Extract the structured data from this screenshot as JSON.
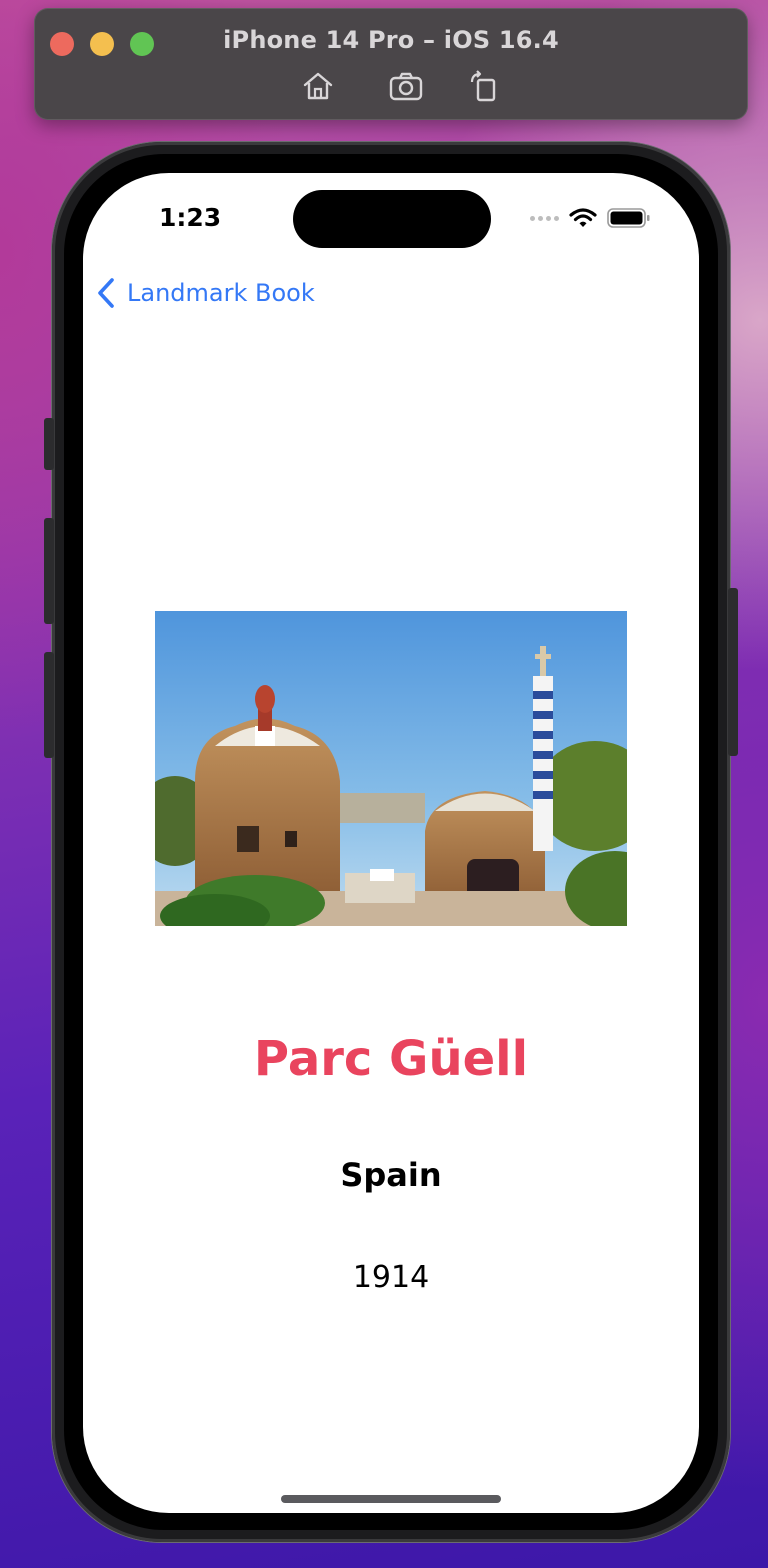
{
  "simulator": {
    "title": "iPhone 14 Pro – iOS 16.4",
    "tools": [
      "home-icon",
      "screenshot-icon",
      "rotate-icon"
    ]
  },
  "status_bar": {
    "time": "1:23",
    "icons": [
      "cellular-dots-icon",
      "wifi-icon",
      "battery-icon"
    ]
  },
  "nav": {
    "back_label": "Landmark Book"
  },
  "landmark": {
    "image": "Parc Güell photo",
    "name": "Parc Güell",
    "country": "Spain",
    "year": "1914",
    "name_color": "#e9445e"
  },
  "colors": {
    "accent": "#3478f6",
    "traffic_red": "#ed6a5e",
    "traffic_yellow": "#f4bf4f",
    "traffic_green": "#61c554"
  }
}
